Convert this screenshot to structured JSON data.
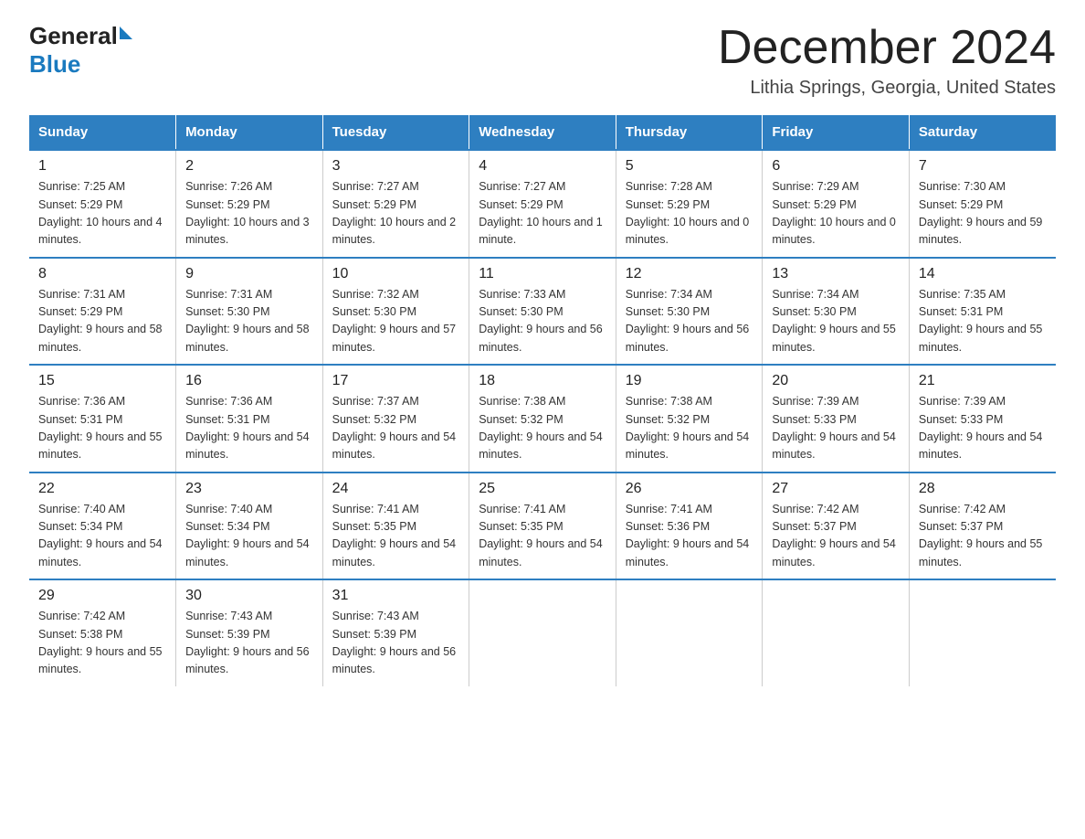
{
  "header": {
    "logo_general": "General",
    "logo_blue": "Blue",
    "title": "December 2024",
    "subtitle": "Lithia Springs, Georgia, United States"
  },
  "days_of_week": [
    "Sunday",
    "Monday",
    "Tuesday",
    "Wednesday",
    "Thursday",
    "Friday",
    "Saturday"
  ],
  "weeks": [
    [
      {
        "day": "1",
        "sunrise": "7:25 AM",
        "sunset": "5:29 PM",
        "daylight": "10 hours and 4 minutes."
      },
      {
        "day": "2",
        "sunrise": "7:26 AM",
        "sunset": "5:29 PM",
        "daylight": "10 hours and 3 minutes."
      },
      {
        "day": "3",
        "sunrise": "7:27 AM",
        "sunset": "5:29 PM",
        "daylight": "10 hours and 2 minutes."
      },
      {
        "day": "4",
        "sunrise": "7:27 AM",
        "sunset": "5:29 PM",
        "daylight": "10 hours and 1 minute."
      },
      {
        "day": "5",
        "sunrise": "7:28 AM",
        "sunset": "5:29 PM",
        "daylight": "10 hours and 0 minutes."
      },
      {
        "day": "6",
        "sunrise": "7:29 AM",
        "sunset": "5:29 PM",
        "daylight": "10 hours and 0 minutes."
      },
      {
        "day": "7",
        "sunrise": "7:30 AM",
        "sunset": "5:29 PM",
        "daylight": "9 hours and 59 minutes."
      }
    ],
    [
      {
        "day": "8",
        "sunrise": "7:31 AM",
        "sunset": "5:29 PM",
        "daylight": "9 hours and 58 minutes."
      },
      {
        "day": "9",
        "sunrise": "7:31 AM",
        "sunset": "5:30 PM",
        "daylight": "9 hours and 58 minutes."
      },
      {
        "day": "10",
        "sunrise": "7:32 AM",
        "sunset": "5:30 PM",
        "daylight": "9 hours and 57 minutes."
      },
      {
        "day": "11",
        "sunrise": "7:33 AM",
        "sunset": "5:30 PM",
        "daylight": "9 hours and 56 minutes."
      },
      {
        "day": "12",
        "sunrise": "7:34 AM",
        "sunset": "5:30 PM",
        "daylight": "9 hours and 56 minutes."
      },
      {
        "day": "13",
        "sunrise": "7:34 AM",
        "sunset": "5:30 PM",
        "daylight": "9 hours and 55 minutes."
      },
      {
        "day": "14",
        "sunrise": "7:35 AM",
        "sunset": "5:31 PM",
        "daylight": "9 hours and 55 minutes."
      }
    ],
    [
      {
        "day": "15",
        "sunrise": "7:36 AM",
        "sunset": "5:31 PM",
        "daylight": "9 hours and 55 minutes."
      },
      {
        "day": "16",
        "sunrise": "7:36 AM",
        "sunset": "5:31 PM",
        "daylight": "9 hours and 54 minutes."
      },
      {
        "day": "17",
        "sunrise": "7:37 AM",
        "sunset": "5:32 PM",
        "daylight": "9 hours and 54 minutes."
      },
      {
        "day": "18",
        "sunrise": "7:38 AM",
        "sunset": "5:32 PM",
        "daylight": "9 hours and 54 minutes."
      },
      {
        "day": "19",
        "sunrise": "7:38 AM",
        "sunset": "5:32 PM",
        "daylight": "9 hours and 54 minutes."
      },
      {
        "day": "20",
        "sunrise": "7:39 AM",
        "sunset": "5:33 PM",
        "daylight": "9 hours and 54 minutes."
      },
      {
        "day": "21",
        "sunrise": "7:39 AM",
        "sunset": "5:33 PM",
        "daylight": "9 hours and 54 minutes."
      }
    ],
    [
      {
        "day": "22",
        "sunrise": "7:40 AM",
        "sunset": "5:34 PM",
        "daylight": "9 hours and 54 minutes."
      },
      {
        "day": "23",
        "sunrise": "7:40 AM",
        "sunset": "5:34 PM",
        "daylight": "9 hours and 54 minutes."
      },
      {
        "day": "24",
        "sunrise": "7:41 AM",
        "sunset": "5:35 PM",
        "daylight": "9 hours and 54 minutes."
      },
      {
        "day": "25",
        "sunrise": "7:41 AM",
        "sunset": "5:35 PM",
        "daylight": "9 hours and 54 minutes."
      },
      {
        "day": "26",
        "sunrise": "7:41 AM",
        "sunset": "5:36 PM",
        "daylight": "9 hours and 54 minutes."
      },
      {
        "day": "27",
        "sunrise": "7:42 AM",
        "sunset": "5:37 PM",
        "daylight": "9 hours and 54 minutes."
      },
      {
        "day": "28",
        "sunrise": "7:42 AM",
        "sunset": "5:37 PM",
        "daylight": "9 hours and 55 minutes."
      }
    ],
    [
      {
        "day": "29",
        "sunrise": "7:42 AM",
        "sunset": "5:38 PM",
        "daylight": "9 hours and 55 minutes."
      },
      {
        "day": "30",
        "sunrise": "7:43 AM",
        "sunset": "5:39 PM",
        "daylight": "9 hours and 56 minutes."
      },
      {
        "day": "31",
        "sunrise": "7:43 AM",
        "sunset": "5:39 PM",
        "daylight": "9 hours and 56 minutes."
      },
      null,
      null,
      null,
      null
    ]
  ]
}
